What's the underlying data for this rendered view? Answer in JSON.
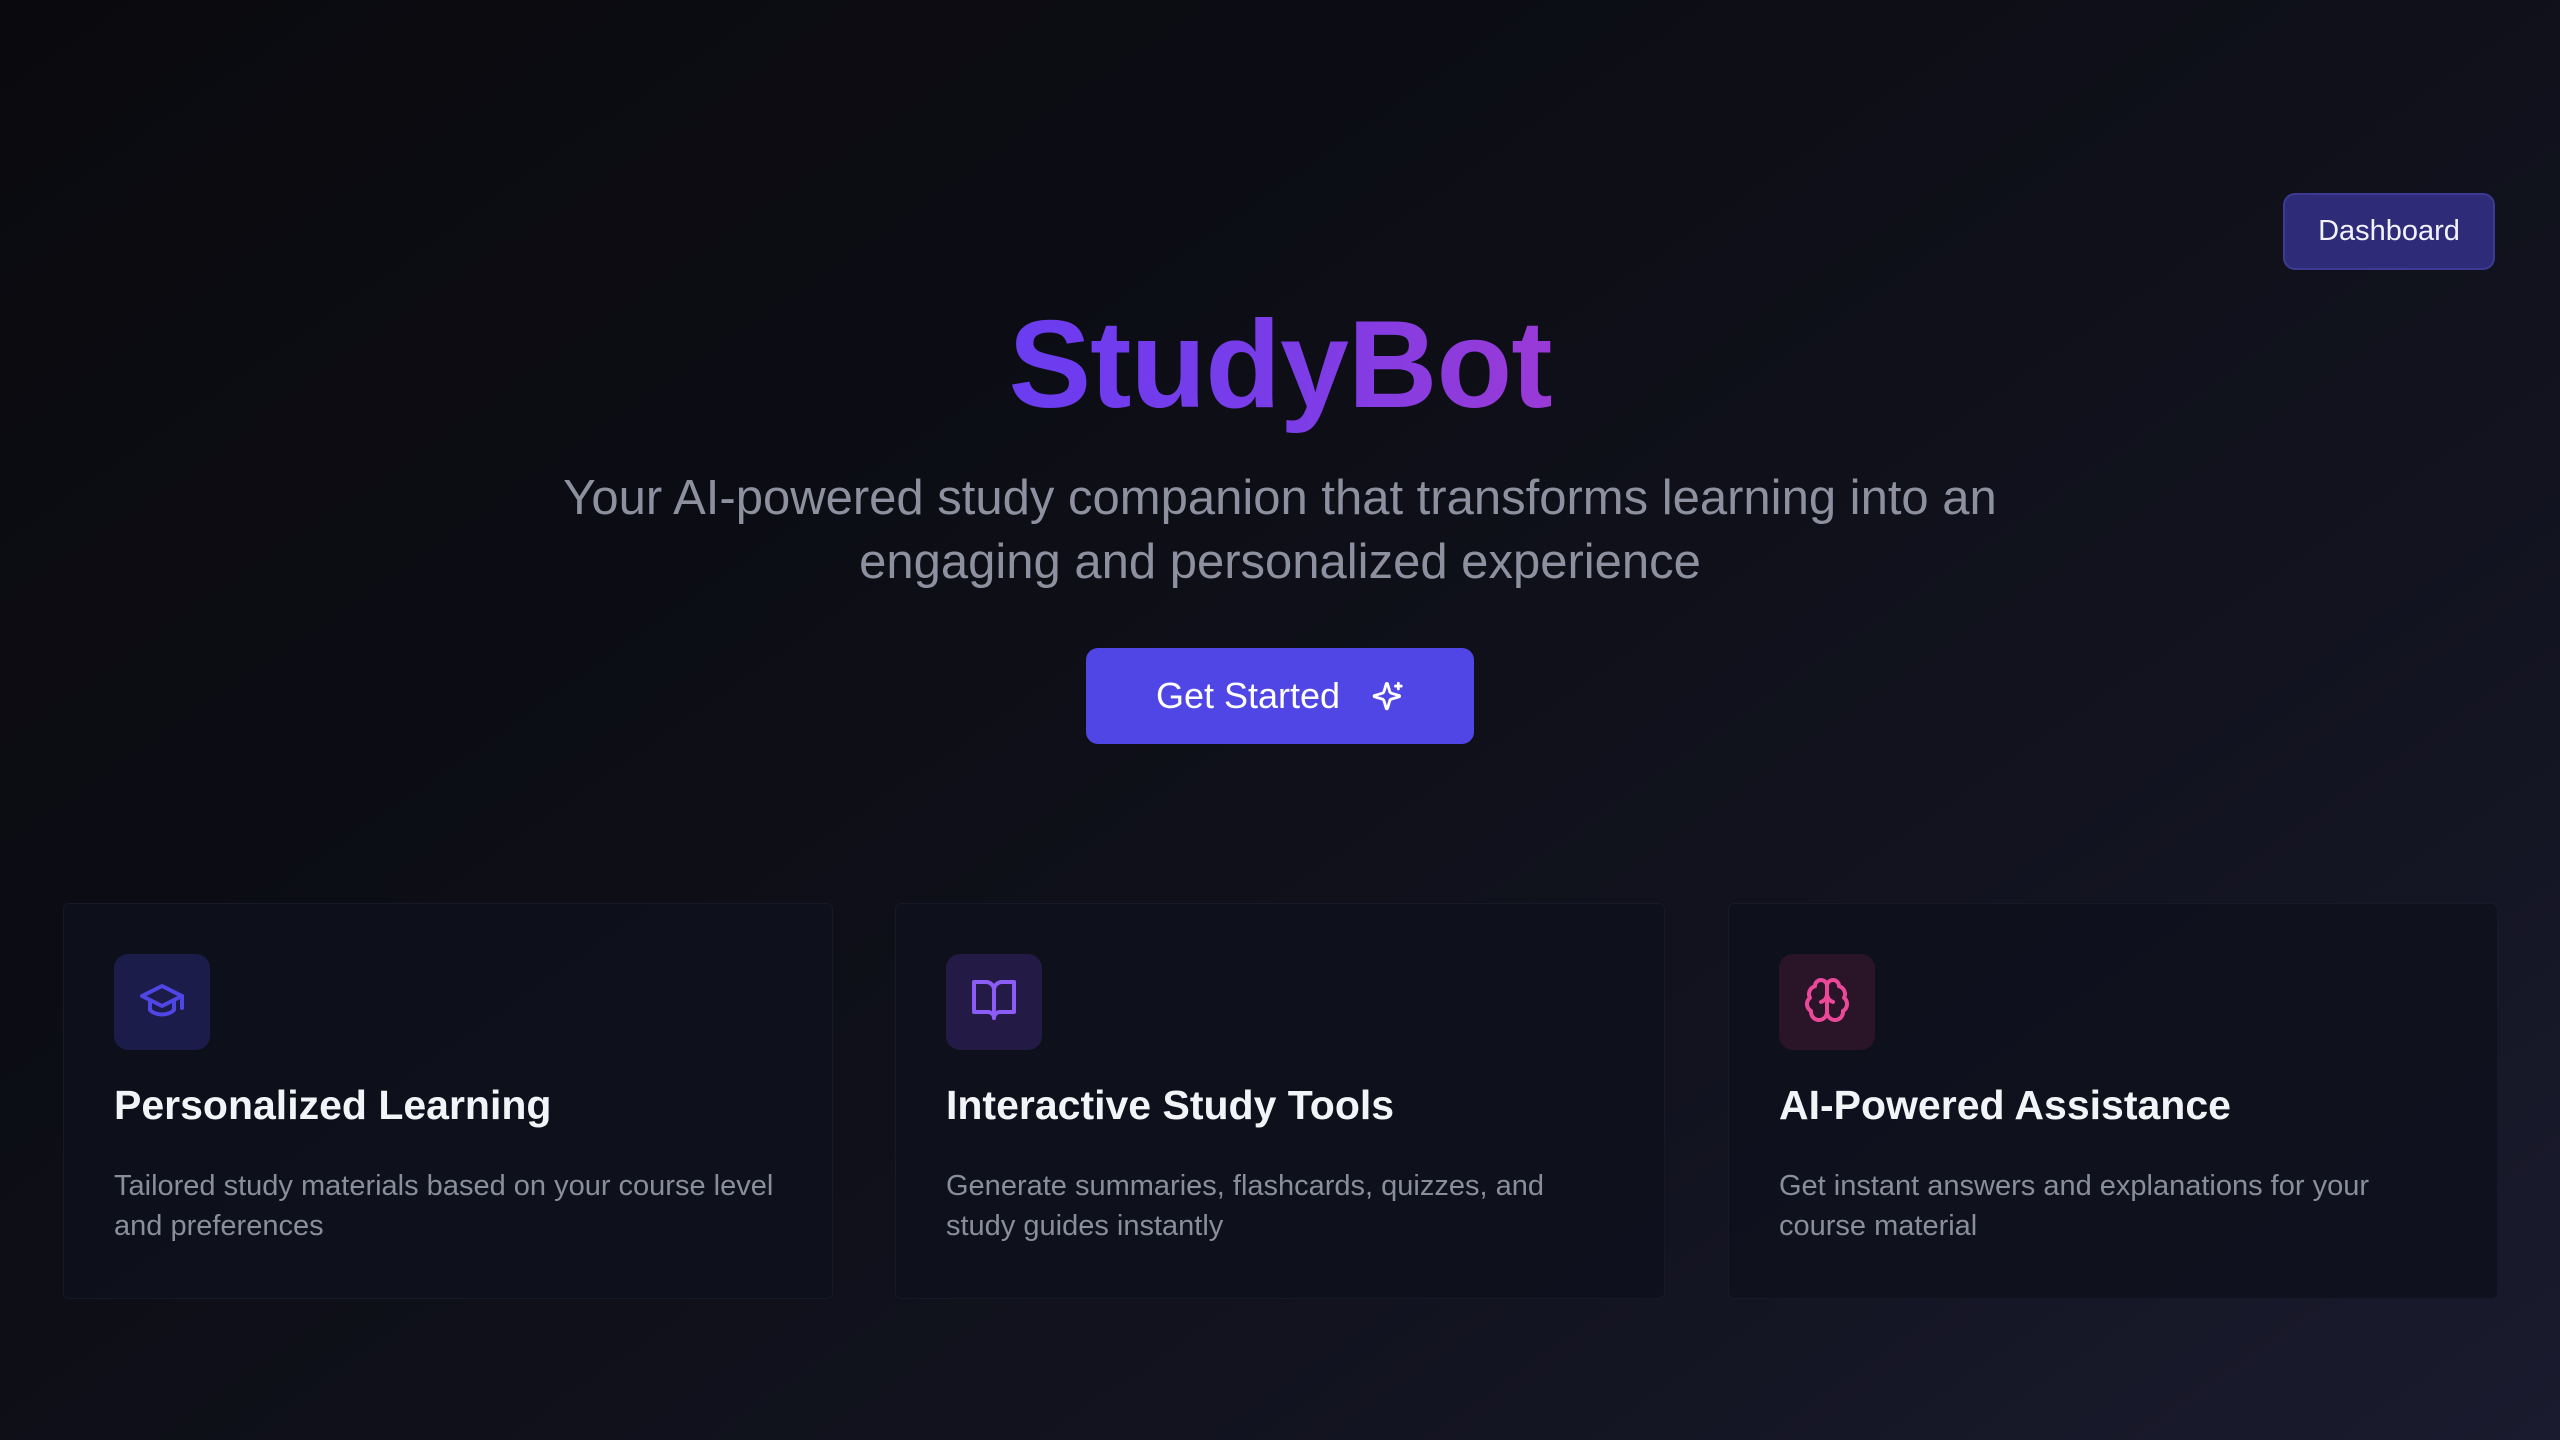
{
  "header": {
    "dashboard_label": "Dashboard"
  },
  "hero": {
    "brand": "StudyBot",
    "tagline": "Your AI-powered study companion that transforms learning into an engaging and personalized experience",
    "cta_label": "Get Started",
    "cta_icon": "sparkles-icon"
  },
  "features": [
    {
      "icon": "graduation-cap-icon",
      "icon_color": "#4f46e5",
      "icon_bg": "#1c1c4a",
      "title": "Personalized Learning",
      "description": "Tailored study materials based on your course level and preferences"
    },
    {
      "icon": "book-open-icon",
      "icon_color": "#8b5cf6",
      "icon_bg": "#231b45",
      "title": "Interactive Study Tools",
      "description": "Generate summaries, flashcards, quizzes, and study guides instantly"
    },
    {
      "icon": "brain-icon",
      "icon_color": "#ec4899",
      "icon_bg": "#2a1428",
      "title": "AI-Powered Assistance",
      "description": "Get instant answers and explanations for your course material"
    }
  ],
  "colors": {
    "accent": "#4f46e5",
    "brand_gradient_start": "#6a3cf0",
    "brand_gradient_end": "#9a3ad6"
  }
}
